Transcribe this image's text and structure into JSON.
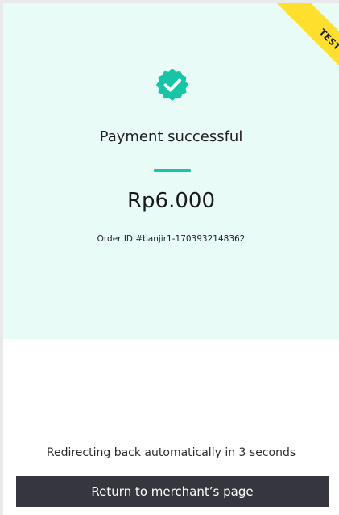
{
  "ribbon": {
    "label": "TEST"
  },
  "status": {
    "icon": "verified-check-icon",
    "title": "Payment successful"
  },
  "payment": {
    "amount": "Rp6.000",
    "order_id": "Order ID #banjir1-1703932148362"
  },
  "redirect": {
    "message": "Redirecting back automatically in 3 seconds"
  },
  "actions": {
    "return_label": "Return to merchant’s page"
  },
  "colors": {
    "accent": "#17c5a6",
    "hero_background": "#e8fbf6",
    "ribbon": "#ffdf2e",
    "button": "#36363e"
  }
}
